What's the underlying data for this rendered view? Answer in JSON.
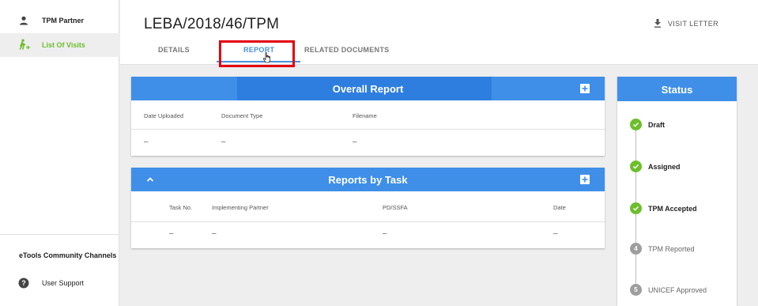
{
  "sidebar": {
    "partner_label": "TPM Partner",
    "visits_label": "List Of Visits",
    "community_label": "eTools Community Channels",
    "support_label": "User Support"
  },
  "header": {
    "title": "LEBA/2018/46/TPM",
    "visit_letter_label": "VISIT LETTER",
    "tabs": [
      {
        "label": "DETAILS"
      },
      {
        "label": "REPORT"
      },
      {
        "label": "RELATED DOCUMENTS"
      }
    ],
    "active_tab": "REPORT"
  },
  "overall_report": {
    "title": "Overall Report",
    "columns": [
      "Date Uploaded",
      "Document Type",
      "Filename"
    ],
    "row": [
      "–",
      "–",
      "–"
    ]
  },
  "reports_by_task": {
    "title": "Reports by Task",
    "columns": [
      "Task No.",
      "Implementing Partner",
      "PD/SSFA",
      "Date"
    ],
    "row": [
      "–",
      "–",
      "–",
      "–"
    ]
  },
  "status": {
    "title": "Status",
    "steps": [
      {
        "label": "Draft",
        "state": "done",
        "number": ""
      },
      {
        "label": "Assigned",
        "state": "done",
        "number": ""
      },
      {
        "label": "TPM Accepted",
        "state": "done",
        "number": ""
      },
      {
        "label": "TPM Reported",
        "state": "todo",
        "number": "4"
      },
      {
        "label": "UNICEF Approved",
        "state": "todo",
        "number": "5"
      }
    ]
  },
  "colors": {
    "accent_blue": "#3f8fe8",
    "active_green": "#6cbe2b",
    "highlight_red": "#e3000f"
  }
}
